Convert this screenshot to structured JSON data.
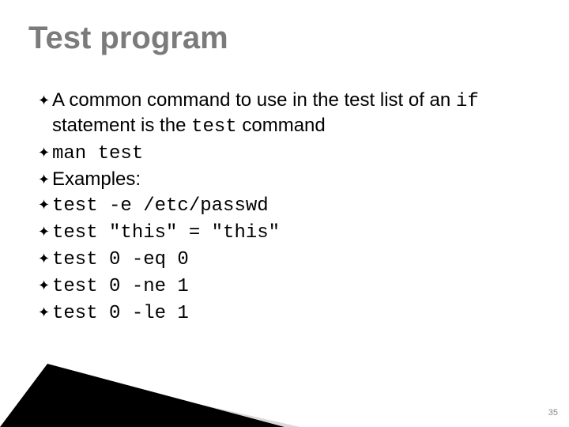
{
  "title": "Test program",
  "bullets": [
    {
      "segments": [
        {
          "text": "A common command to use in the test list of an ",
          "mono": false
        },
        {
          "text": "if",
          "mono": true
        },
        {
          "text": " statement is the ",
          "mono": false
        },
        {
          "text": "test",
          "mono": true
        },
        {
          "text": " command",
          "mono": false
        }
      ]
    },
    {
      "segments": [
        {
          "text": "man test",
          "mono": true
        }
      ]
    },
    {
      "segments": [
        {
          "text": "Examples:",
          "mono": false
        }
      ]
    },
    {
      "segments": [
        {
          "text": "test -e /etc/passwd",
          "mono": true
        }
      ]
    },
    {
      "segments": [
        {
          "text": "test \"this\" = \"this\"",
          "mono": true
        }
      ]
    },
    {
      "segments": [
        {
          "text": "test 0 -eq 0",
          "mono": true
        }
      ]
    },
    {
      "segments": [
        {
          "text": "test 0 -ne 1",
          "mono": true
        }
      ]
    },
    {
      "segments": [
        {
          "text": "test 0 -le 1",
          "mono": true
        }
      ]
    }
  ],
  "page_number": "35",
  "glyphs": {
    "bullet": "✦"
  }
}
